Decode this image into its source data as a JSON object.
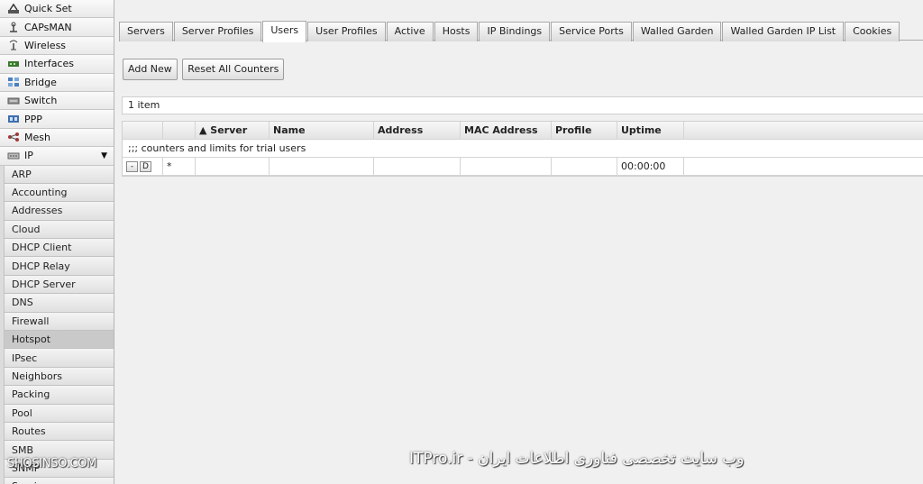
{
  "sidebar": {
    "items": [
      {
        "label": "Quick Set",
        "icon": "quick-set-icon"
      },
      {
        "label": "CAPsMAN",
        "icon": "capsman-icon"
      },
      {
        "label": "Wireless",
        "icon": "wireless-icon"
      },
      {
        "label": "Interfaces",
        "icon": "interfaces-icon"
      },
      {
        "label": "Bridge",
        "icon": "bridge-icon"
      },
      {
        "label": "Switch",
        "icon": "switch-icon"
      },
      {
        "label": "PPP",
        "icon": "ppp-icon"
      },
      {
        "label": "Mesh",
        "icon": "mesh-icon"
      },
      {
        "label": "IP",
        "icon": "ip-icon",
        "caret": "▼"
      }
    ],
    "submenu": [
      "ARP",
      "Accounting",
      "Addresses",
      "Cloud",
      "DHCP Client",
      "DHCP Relay",
      "DHCP Server",
      "DNS",
      "Firewall",
      "Hotspot",
      "IPsec",
      "Neighbors",
      "Packing",
      "Pool",
      "Routes",
      "SMB",
      "SNMP",
      "Services"
    ],
    "submenu_active": "Hotspot"
  },
  "tabs": [
    "Servers",
    "Server Profiles",
    "Users",
    "User Profiles",
    "Active",
    "Hosts",
    "IP Bindings",
    "Service Ports",
    "Walled Garden",
    "Walled Garden IP List",
    "Cookies"
  ],
  "active_tab": "Users",
  "toolbar": {
    "add_new": "Add New",
    "reset_counters": "Reset All Counters"
  },
  "item_count": "1 item",
  "table": {
    "columns": [
      "",
      "",
      "▲ Server",
      "Name",
      "Address",
      "MAC Address",
      "Profile",
      "Uptime"
    ],
    "comment": ";;; counters and limits for trial users",
    "row": {
      "remove": "-",
      "disable": "D",
      "flag": "*",
      "server": "",
      "name": "",
      "address": "",
      "mac": "",
      "profile": "",
      "uptime": "00:00:00"
    }
  },
  "watermarks": {
    "left": "SHOSINSO.COM",
    "bottom": "ITPro.ir - وب سایت تخصصی فناوری اطلاعات ایران"
  },
  "colors": {
    "background": "#f0f0f0",
    "sidebar": "#e6e6e6",
    "active_item": "#c9c9c9"
  }
}
